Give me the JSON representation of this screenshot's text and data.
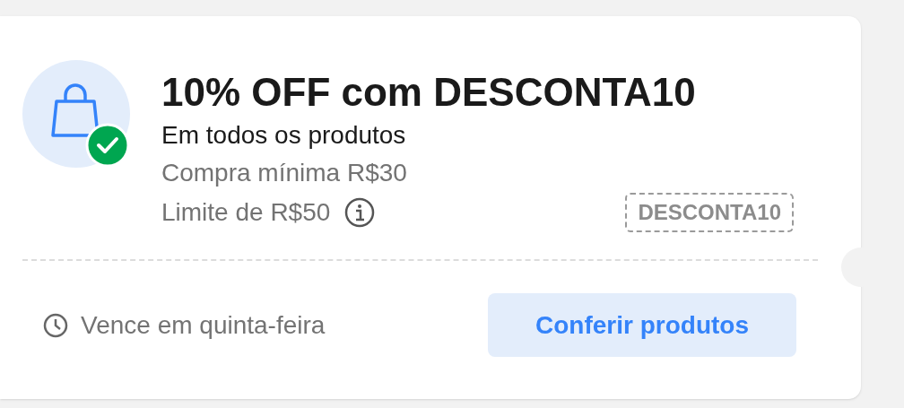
{
  "coupon": {
    "title": "10% OFF com DESCONTA10",
    "scope": "Em todos os produtos",
    "minimum": "Compra mínima R$30",
    "limit": "Limite de R$50",
    "code": "DESCONTA10",
    "applied": true,
    "expiry": "Vence em quinta-feira",
    "action": "Conferir produtos"
  }
}
